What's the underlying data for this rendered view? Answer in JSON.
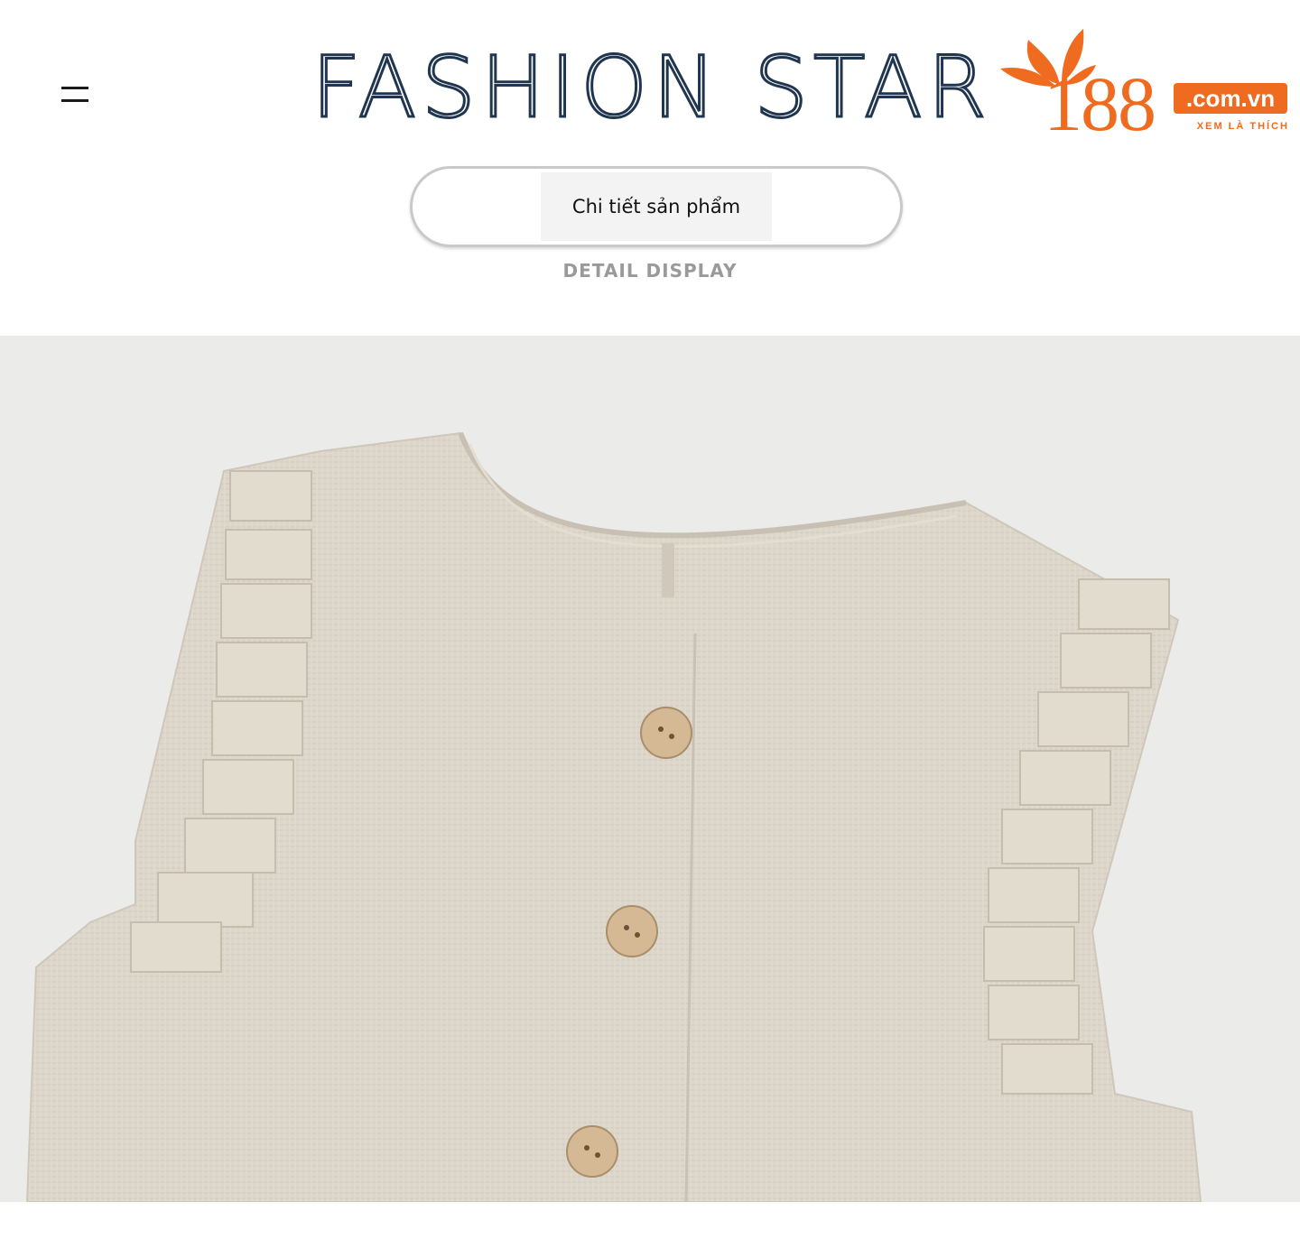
{
  "header": {
    "menu_icon": "hamburger-menu-icon",
    "brand_title": "FASHION STAR",
    "logo": {
      "number": "188",
      "domain": ".com.vn",
      "slogan": "XEM LÀ THÍCH",
      "leaf_icon": "leaf-icon",
      "brand_color": "#ef6b1f"
    }
  },
  "section": {
    "pill_label": "Chi tiết sản phẩm",
    "subtitle": "DETAIL DISPLAY"
  },
  "colors": {
    "title_stroke": "#1f3550",
    "pill_border": "#c9c9c9",
    "photo_background": "#ebebe9",
    "fabric": "#ddd6ca",
    "button": "#d4b994"
  }
}
